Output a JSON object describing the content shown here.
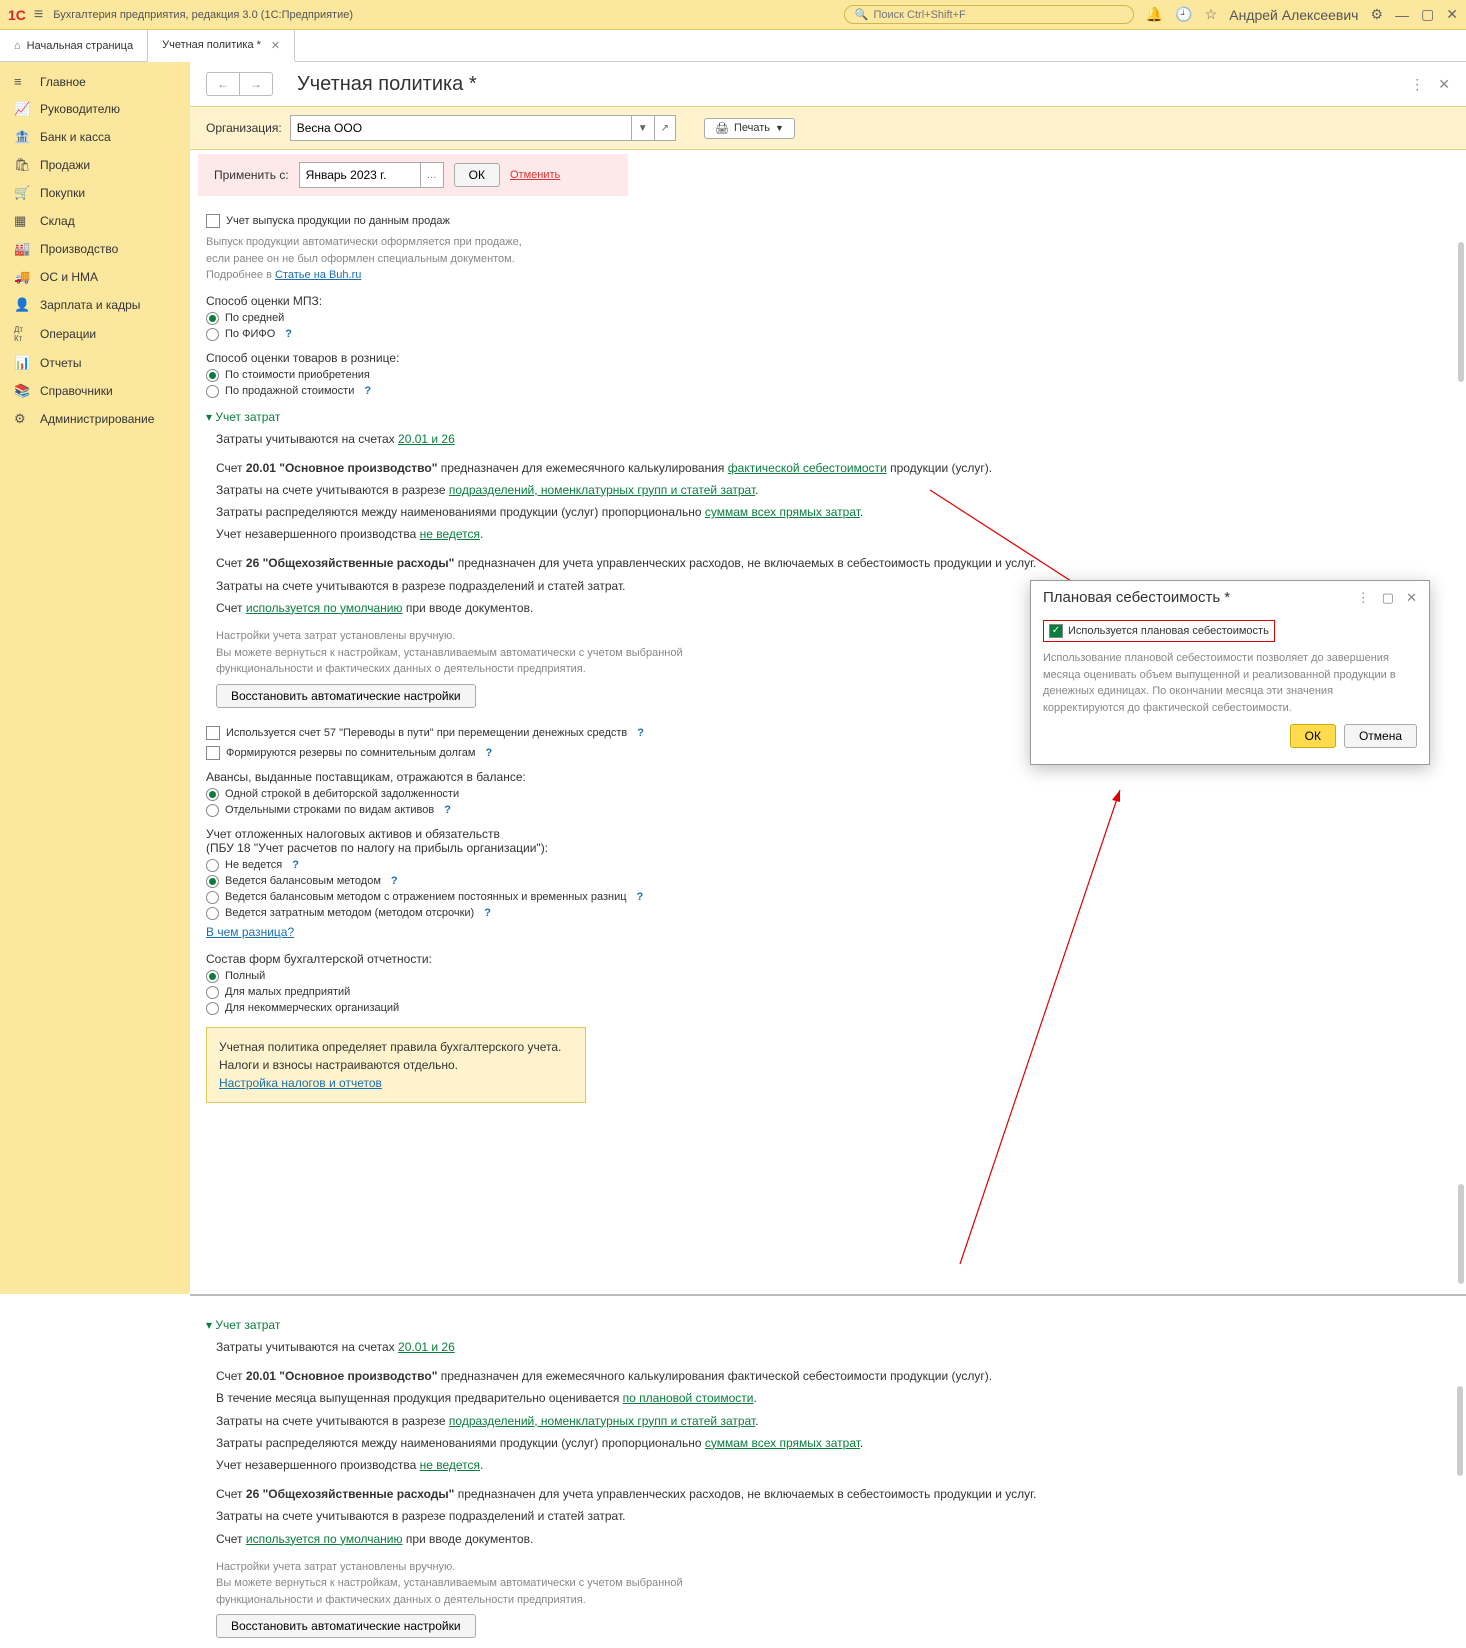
{
  "titlebar": {
    "logo": "1C",
    "title": "Бухгалтерия предприятия, редакция 3.0  (1С:Предприятие)",
    "search_placeholder": "Поиск Ctrl+Shift+F",
    "username": "Андрей Алексеевич"
  },
  "tabs": {
    "home": "Начальная страница",
    "active": "Учетная политика *"
  },
  "sidebar": [
    {
      "icon": "≡",
      "label": "Главное"
    },
    {
      "icon": "📈",
      "label": "Руководителю"
    },
    {
      "icon": "🏦",
      "label": "Банк и касса"
    },
    {
      "icon": "🛍",
      "label": "Продажи"
    },
    {
      "icon": "🛒",
      "label": "Покупки"
    },
    {
      "icon": "▦",
      "label": "Склад"
    },
    {
      "icon": "🏭",
      "label": "Производство"
    },
    {
      "icon": "🚚",
      "label": "ОС и НМА"
    },
    {
      "icon": "👤",
      "label": "Зарплата и кадры"
    },
    {
      "icon": "Дт Кт",
      "label": "Операции"
    },
    {
      "icon": "📊",
      "label": "Отчеты"
    },
    {
      "icon": "📚",
      "label": "Справочники"
    },
    {
      "icon": "⚙",
      "label": "Администрирование"
    }
  ],
  "page": {
    "title": "Учетная политика *",
    "org_label": "Организация:",
    "org_value": "Весна ООО",
    "print": "Печать",
    "apply_label": "Применить с:",
    "apply_value": "Январь 2023 г.",
    "ok": "ОК",
    "cancel": "Отменить"
  },
  "s1": {
    "chk_label": "Учет выпуска продукции по данным продаж",
    "note1": "Выпуск продукции автоматически оформляется при продаже,",
    "note2": "если ранее он не был оформлен специальным документом.",
    "note3": "Подробнее в ",
    "note3_link": "Статье на Buh.ru"
  },
  "mpz": {
    "header": "Способ оценки МПЗ:",
    "opt1": "По средней",
    "opt2": "По ФИФО"
  },
  "retail": {
    "header": "Способ оценки товаров в рознице:",
    "opt1": "По стоимости приобретения",
    "opt2": "По продажной стоимости"
  },
  "costs": {
    "header": "Учет затрат",
    "line1a": "Затраты учитываются на счетах ",
    "line1_link": "20.01 и 26",
    "p2a": "Счет ",
    "p2b": "20.01 \"Основное производство\"",
    "p2c": " предназначен для ежемесячного калькулирования ",
    "p2_link": "фактической себестоимости",
    "p2d": " продукции (услуг).",
    "p3a": "Затраты на счете учитываются в разрезе ",
    "p3_link": "подразделений, номенклатурных групп и статей затрат",
    "p3b": ".",
    "p4a": "Затраты распределяются между наименованиями продукции (услуг) пропорционально ",
    "p4_link": "суммам всех прямых затрат",
    "p4b": ".",
    "p5a": "Учет незавершенного производства ",
    "p5_link": "не ведется",
    "p5b": ".",
    "p6a": "Счет ",
    "p6b": "26 \"Общехозяйственные расходы\"",
    "p6c": " предназначен для учета управленческих расходов, не включаемых в себестоимость продукции и услуг.",
    "p7": "Затраты на счете учитываются в разрезе подразделений и статей затрат.",
    "p8a": "Счет ",
    "p8_link": "используется по умолчанию",
    "p8b": " при вводе документов.",
    "manual1": "Настройки учета затрат установлены вручную.",
    "manual2": "Вы можете вернуться к настройкам, устанавливаемым автоматически с учетом выбранной",
    "manual3": "функциональности и фактических данных о деятельности предприятия.",
    "restore_btn": "Восстановить автоматические настройки"
  },
  "misc": {
    "chk57": "Используется счет 57 \"Переводы в пути\" при перемещении денежных средств",
    "chk_reserve": "Формируются резервы по сомнительным долгам"
  },
  "advances": {
    "header": "Авансы, выданные поставщикам, отражаются в балансе:",
    "opt1": "Одной строкой в дебиторской задолженности",
    "opt2": "Отдельными строками по видам активов"
  },
  "deferred": {
    "header1": "Учет отложенных налоговых активов и обязательств",
    "header2": "(ПБУ 18 \"Учет расчетов по налогу на прибыль организации\"):",
    "opt1": "Не ведется",
    "opt2": "Ведется балансовым методом",
    "opt3": "Ведется балансовым методом с отражением постоянных и временных разниц",
    "opt4": "Ведется затратным методом (методом отсрочки)",
    "diff_link": "В чем разница?"
  },
  "forms": {
    "header": "Состав форм бухгалтерской отчетности:",
    "opt1": "Полный",
    "opt2": "Для малых предприятий",
    "opt3": "Для некоммерческих организаций"
  },
  "footer_box": {
    "line1": "Учетная политика определяет правила бухгалтерского учета.",
    "line2": "Налоги и взносы настраиваются отдельно.",
    "link": "Настройка налогов и отчетов"
  },
  "popup": {
    "title": "Плановая себестоимость *",
    "chk": "Используется плановая себестоимость",
    "note": "Использование плановой себестоимости позволяет до завершения месяца оценивать объем выпущенной и реализованной продукции в денежных единицах. По окончании месяца эти значения корректируются до фактической себестоимости.",
    "ok": "ОК",
    "cancel": "Отмена"
  },
  "lower": {
    "header": "Учет затрат",
    "l1a": "Затраты учитываются на счетах ",
    "l1_link": "20.01 и 26",
    "l2a": "Счет ",
    "l2b": "20.01 \"Основное производство\"",
    "l2c": " предназначен для ежемесячного калькулирования фактической себестоимости продукции (услуг).",
    "l3a": "В течение месяца выпущенная продукция предварительно оценивается ",
    "l3_link": "по плановой стоимости",
    "l3b": ".",
    "l4a": "Затраты на счете учитываются в разрезе ",
    "l4_link": "подразделений, номенклатурных групп и статей затрат",
    "l4b": ".",
    "l5a": "Затраты распределяются между наименованиями продукции (услуг) пропорционально ",
    "l5_link": "суммам всех прямых затрат",
    "l5b": ".",
    "l6a": "Учет незавершенного производства ",
    "l6_link": "не ведется",
    "l6b": ".",
    "l7a": "Счет ",
    "l7b": "26 \"Общехозяйственные расходы\"",
    "l7c": " предназначен для учета управленческих расходов, не включаемых в себестоимость продукции и услуг.",
    "l8": "Затраты на счете учитываются в разрезе подразделений и статей затрат.",
    "l9a": "Счет ",
    "l9_link": "используется по умолчанию",
    "l9b": " при вводе документов."
  }
}
